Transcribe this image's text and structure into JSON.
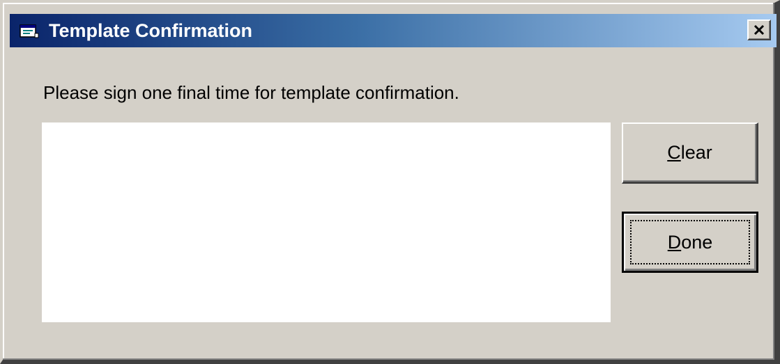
{
  "window": {
    "title": "Template Confirmation",
    "icon": "window-app-icon",
    "close_label": "X"
  },
  "dialog": {
    "prompt": "Please sign one final time for template confirmation."
  },
  "buttons": {
    "clear": {
      "mnemonic": "C",
      "rest": "lear"
    },
    "done": {
      "mnemonic": "D",
      "rest": "one"
    }
  },
  "colors": {
    "face": "#d4d0c8",
    "title_start": "#0a246a",
    "title_end": "#a6caf0",
    "pad": "#ffffff"
  }
}
